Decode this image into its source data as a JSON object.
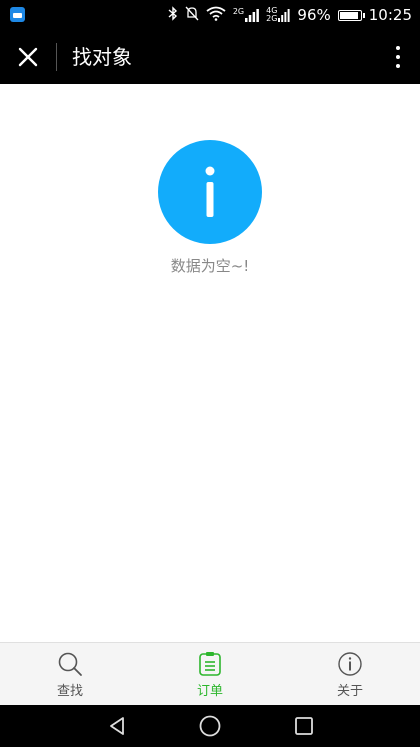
{
  "status_bar": {
    "network_small_1": "2G",
    "network_small_2": "4G",
    "network_small_3": "2G",
    "battery_percent": "96%",
    "battery_level": 0.96,
    "time": "10:25"
  },
  "app_bar": {
    "title": "找对象"
  },
  "empty_state": {
    "message": "数据为空~!",
    "icon_color": "#12ACFB"
  },
  "tabs": [
    {
      "label": "查找",
      "icon": "search-icon",
      "active": false
    },
    {
      "label": "订单",
      "icon": "clipboard-icon",
      "active": true
    },
    {
      "label": "关于",
      "icon": "info-icon",
      "active": false
    }
  ],
  "colors": {
    "active_tab": "#2DB62D",
    "inactive_tab": "#555555",
    "accent": "#12ACFB"
  }
}
